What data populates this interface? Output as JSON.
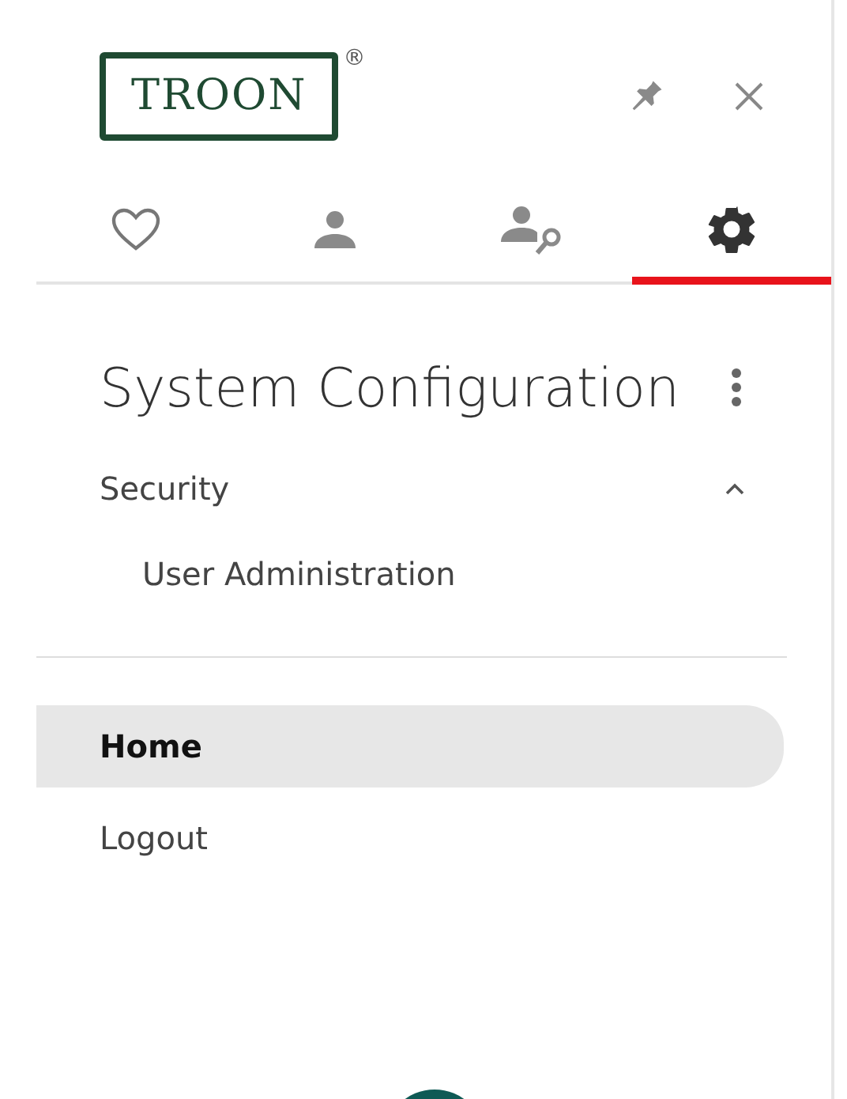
{
  "logo": {
    "text": "TROON",
    "mark": "®"
  },
  "tabs": [
    {
      "kind": "heart",
      "selected": false
    },
    {
      "kind": "person",
      "selected": false
    },
    {
      "kind": "person-key",
      "selected": false
    },
    {
      "kind": "gear",
      "selected": true
    }
  ],
  "section": {
    "title": "System Configuration",
    "groups": [
      {
        "label": "Security",
        "expanded": true,
        "children": [
          {
            "label": "User Administration"
          }
        ]
      }
    ]
  },
  "nav": [
    {
      "label": "Home",
      "selected": true
    },
    {
      "label": "Logout",
      "selected": false
    }
  ]
}
